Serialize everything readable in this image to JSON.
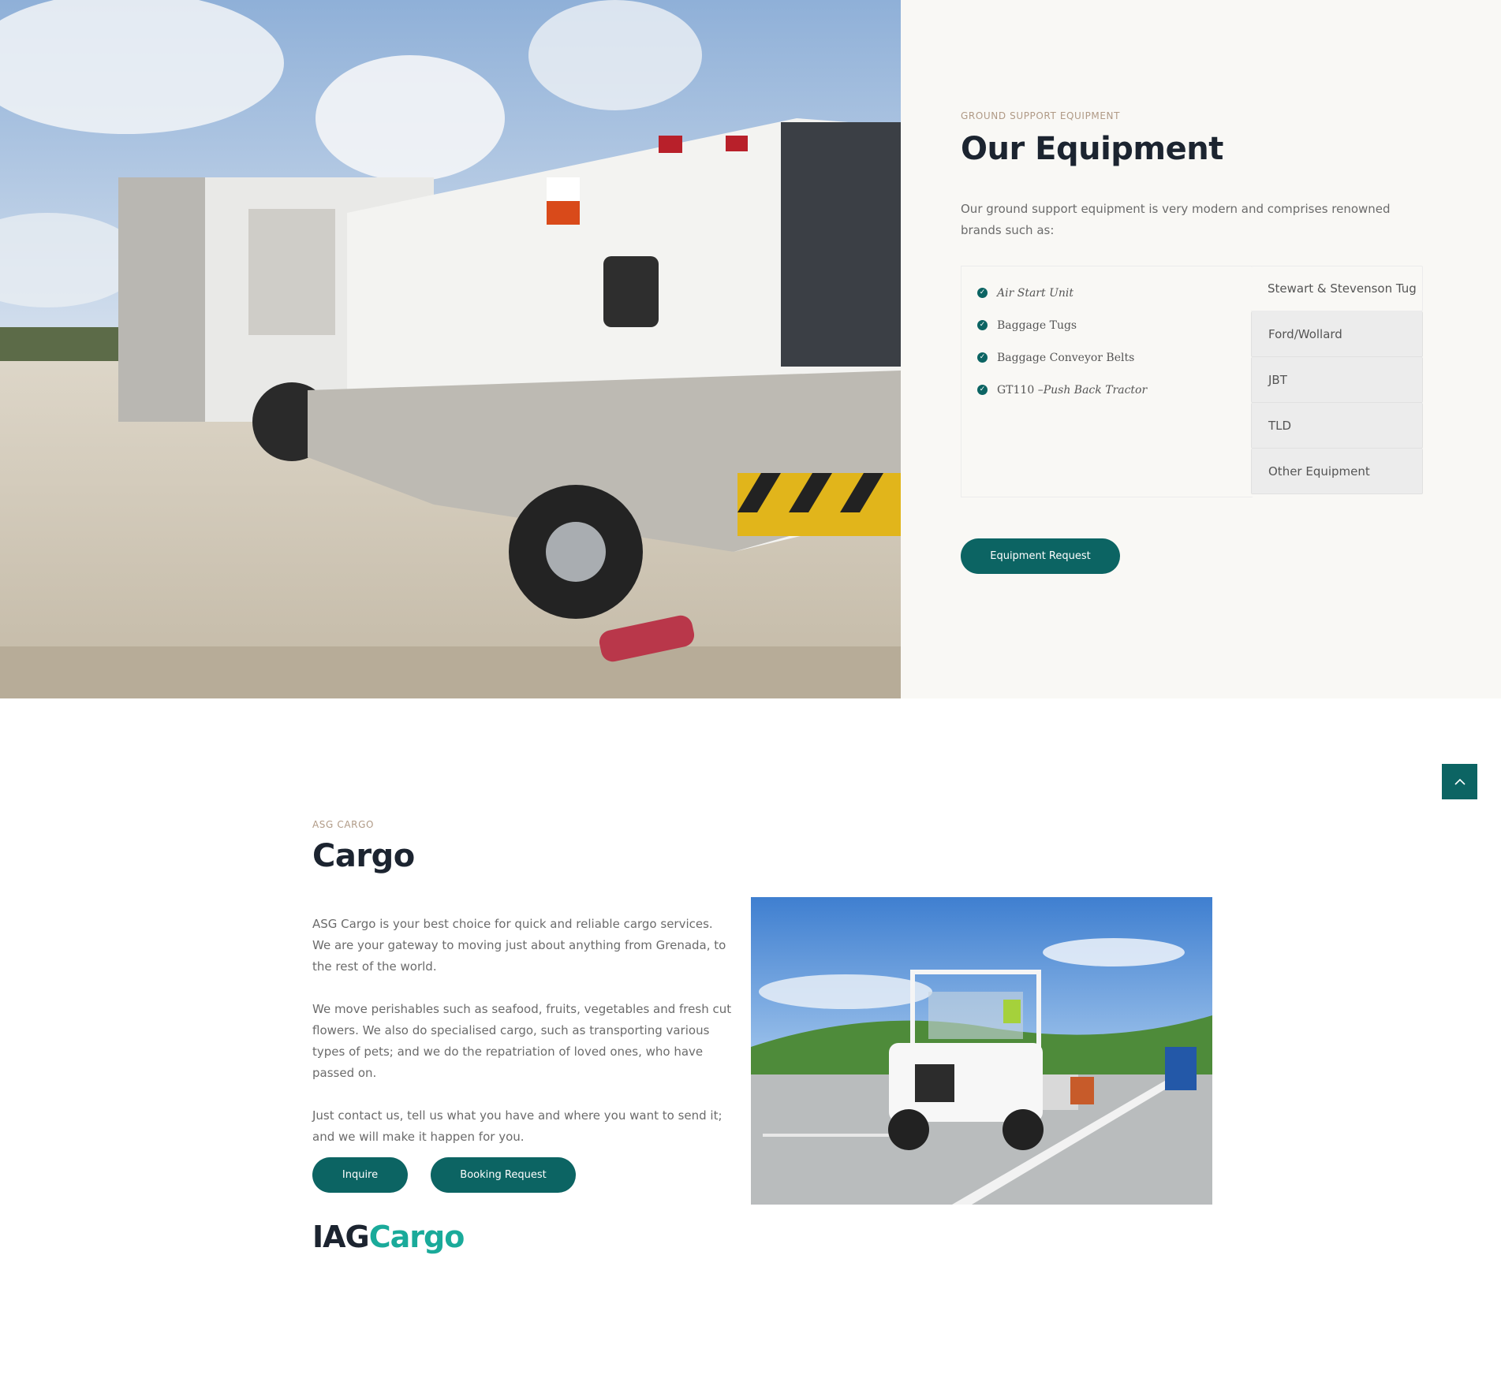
{
  "equipment": {
    "eyebrow": "GROUND SUPPORT EQUIPMENT",
    "title": "Our Equipment",
    "intro": "Our ground support equipment is very modern and comprises renowned brands such as:",
    "photo_icon": "ground-power-unit-photo",
    "active_tab_items": [
      {
        "prefix": "",
        "label": "Air Start Unit"
      },
      {
        "prefix": "",
        "label": "Baggage Tugs"
      },
      {
        "prefix": "",
        "label": "Baggage Conveyor Belts"
      },
      {
        "prefix": "GT110 – ",
        "label": "Push Back Tractor"
      }
    ],
    "tabs": [
      {
        "label": "Stewart & Stevenson Tug"
      },
      {
        "label": "Ford/Wollard"
      },
      {
        "label": "JBT"
      },
      {
        "label": "TLD"
      },
      {
        "label": "Other Equipment"
      }
    ],
    "request_button": "Equipment Request"
  },
  "cargo": {
    "eyebrow": "ASG CARGO",
    "title": "Cargo",
    "paragraphs": [
      "ASG Cargo is your best choice for quick and reliable cargo services. We are your gateway to moving just about anything from Grenada, to the rest of the world.",
      "We move perishables such as seafood, fruits, vegetables and fresh cut flowers. We also do specialised cargo, such as transporting various types of pets; and we do the repatriation of loved ones, who have passed on.",
      "Just contact us, tell us what you have and where you want to send it; and we will make it happen for you."
    ],
    "inquire_button": "Inquire",
    "booking_button": "Booking Request",
    "logo_part1": "IAG",
    "logo_part2": "Cargo",
    "photo_icon": "baggage-tractor-photo"
  },
  "colors": {
    "accent": "#0c6463",
    "heading": "#1c2430",
    "eyebrow": "#b09a86",
    "logo_teal": "#1aaa9a"
  },
  "back_to_top_icon": "chevron-up-icon"
}
